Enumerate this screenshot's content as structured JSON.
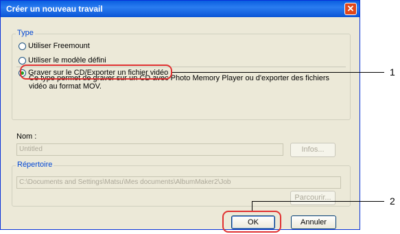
{
  "dialog": {
    "title": "Créer un nouveau travail",
    "close_glyph": "✕"
  },
  "type_group": {
    "legend": "Type",
    "options": [
      {
        "label": "Utiliser Freemount",
        "selected": false
      },
      {
        "label": "Utiliser le modèle défini",
        "selected": false
      },
      {
        "label": "Graver sur le CD/Exporter un fichier vidéo",
        "selected": true
      }
    ],
    "description": "Ce type permet de graver sur un CD avec Photo Memory Player ou d'exporter des fichiers vidéo au format MOV."
  },
  "name": {
    "label": "Nom :",
    "value": "Untitled",
    "info_button": "Infos..."
  },
  "directory": {
    "legend": "Répertoire",
    "value": "C:\\Documents and Settings\\Matsu\\Mes documents\\AlbumMaker2\\Job",
    "browse_button": "Parcourir..."
  },
  "buttons": {
    "ok": "OK",
    "cancel": "Annuler"
  },
  "callouts": {
    "one": "1",
    "two": "2",
    "color": "#e03030"
  }
}
